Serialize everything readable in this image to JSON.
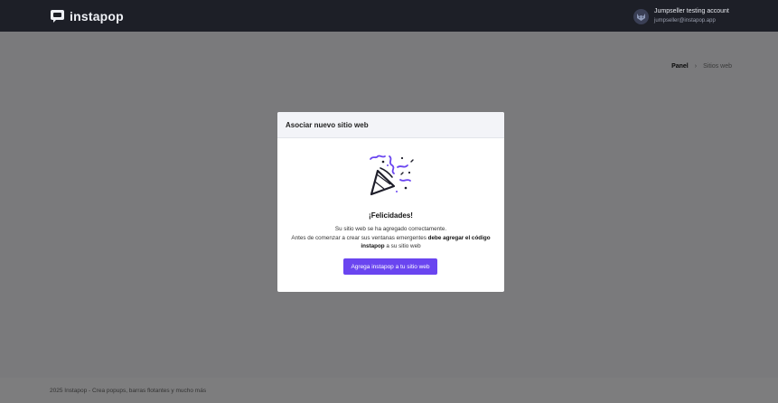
{
  "app": {
    "name": "instapop"
  },
  "account": {
    "name": "Jumpseller testing account",
    "email": "jumpseller@instapop.app"
  },
  "breadcrumb": {
    "home": "Panel",
    "separator": "›",
    "current": "Sitios web"
  },
  "footer": {
    "text": "2025 Instapop - Crea popups, barras flotantes y mucho más"
  },
  "modal": {
    "title": "Asociar nuevo sitio web",
    "heading": "¡Felicidades!",
    "line1": "Su sitio web se ha agregado correctamente.",
    "line2_pre": "Antes de comenzar a crear sus ventanas emergentes ",
    "line2_bold": "debe agregar el código",
    "line3_bold": "instapop",
    "line3_post": " a su sitio web",
    "button_label": "Agrega instapop a tu sitio web"
  },
  "colors": {
    "accent": "#6a45f0",
    "topbar": "#1d1f27"
  },
  "icons": {
    "logo": "instapop-logo-icon",
    "avatar": "user-avatar-icon",
    "illustration": "party-popper-icon"
  }
}
